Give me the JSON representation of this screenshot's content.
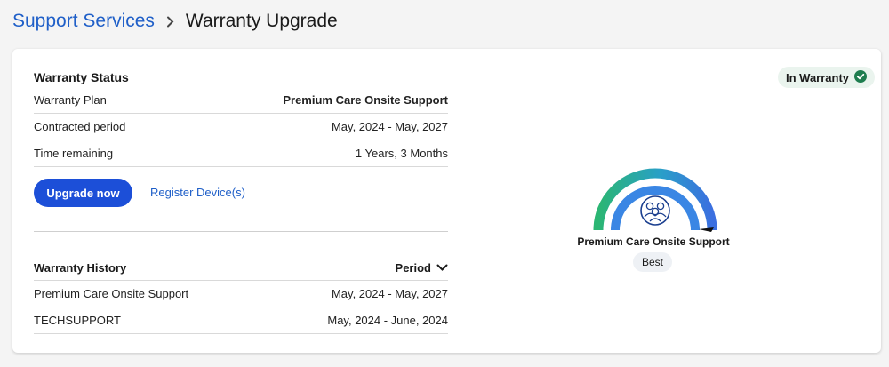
{
  "breadcrumb": {
    "parent": "Support Services",
    "current": "Warranty Upgrade"
  },
  "warranty_status": {
    "title": "Warranty Status",
    "rows": [
      {
        "label": "Warranty Plan",
        "value": "Premium Care Onsite Support"
      },
      {
        "label": "Contracted period",
        "value": "May, 2024 - May, 2027"
      },
      {
        "label": "Time remaining",
        "value": "1 Years, 3 Months"
      }
    ]
  },
  "actions": {
    "upgrade_label": "Upgrade now",
    "register_label": "Register Device(s)"
  },
  "badge": {
    "label": "In Warranty",
    "icon": "check-circle-icon",
    "color": "#1e7d4f"
  },
  "history": {
    "title": "Warranty History",
    "sort_label": "Period",
    "rows": [
      {
        "plan": "Premium Care Onsite Support",
        "period": "May, 2024 - May, 2027"
      },
      {
        "plan": "TECHSUPPORT",
        "period": "May, 2024 - June, 2024"
      }
    ]
  },
  "coverage": {
    "plan_name": "Premium Care Onsite Support",
    "tier": "Best",
    "gauge_colors": [
      "#2bb673",
      "#2a8fd8",
      "#3b6fe0"
    ],
    "icon": "support-people-icon"
  },
  "colors": {
    "accent": "#1c4fd8",
    "link": "#1f5fc8"
  }
}
